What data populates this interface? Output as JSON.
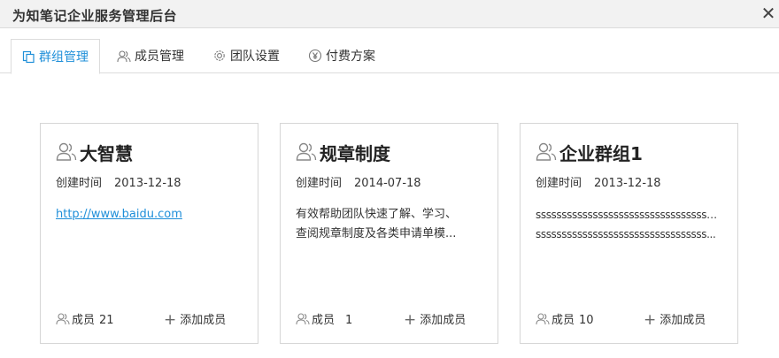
{
  "window": {
    "title": "为知笔记企业服务管理后台",
    "close_glyph": "✕"
  },
  "tabs": [
    {
      "label": "群组管理",
      "icon": "group-doc-icon",
      "active": true
    },
    {
      "label": "成员管理",
      "icon": "members-icon",
      "active": false
    },
    {
      "label": "团队设置",
      "icon": "gear-icon",
      "active": false
    },
    {
      "label": "付费方案",
      "icon": "yen-icon",
      "active": false
    }
  ],
  "groups": [
    {
      "name": "大智慧",
      "created_label": "创建时间",
      "created_date": "2013-12-18",
      "desc_lines": [
        "http://www.baidu.com"
      ],
      "desc_is_link": true,
      "members_label": "成员",
      "member_count": "21",
      "add_label": "添加成员"
    },
    {
      "name": "规章制度",
      "created_label": "创建时间",
      "created_date": "2014-07-18",
      "desc_lines": [
        "有效帮助团队快速了解、学习、",
        "查阅规章制度及各类申请单模..."
      ],
      "desc_is_link": false,
      "members_label": "成员",
      "member_count": "1",
      "add_label": "添加成员"
    },
    {
      "name": "企业群组1",
      "created_label": "创建时间",
      "created_date": "2013-12-18",
      "desc_lines": [
        "ssssssssssssssssssssssssssssssssssss",
        "sssssssssssssssssssssssssssssssss..."
      ],
      "desc_is_link": false,
      "members_label": "成员",
      "member_count": "10",
      "add_label": "添加成员"
    }
  ],
  "colors": {
    "accent": "#1f8fd9",
    "border": "#d6d6d6",
    "titlebar_bg": "#f2f2f2"
  }
}
